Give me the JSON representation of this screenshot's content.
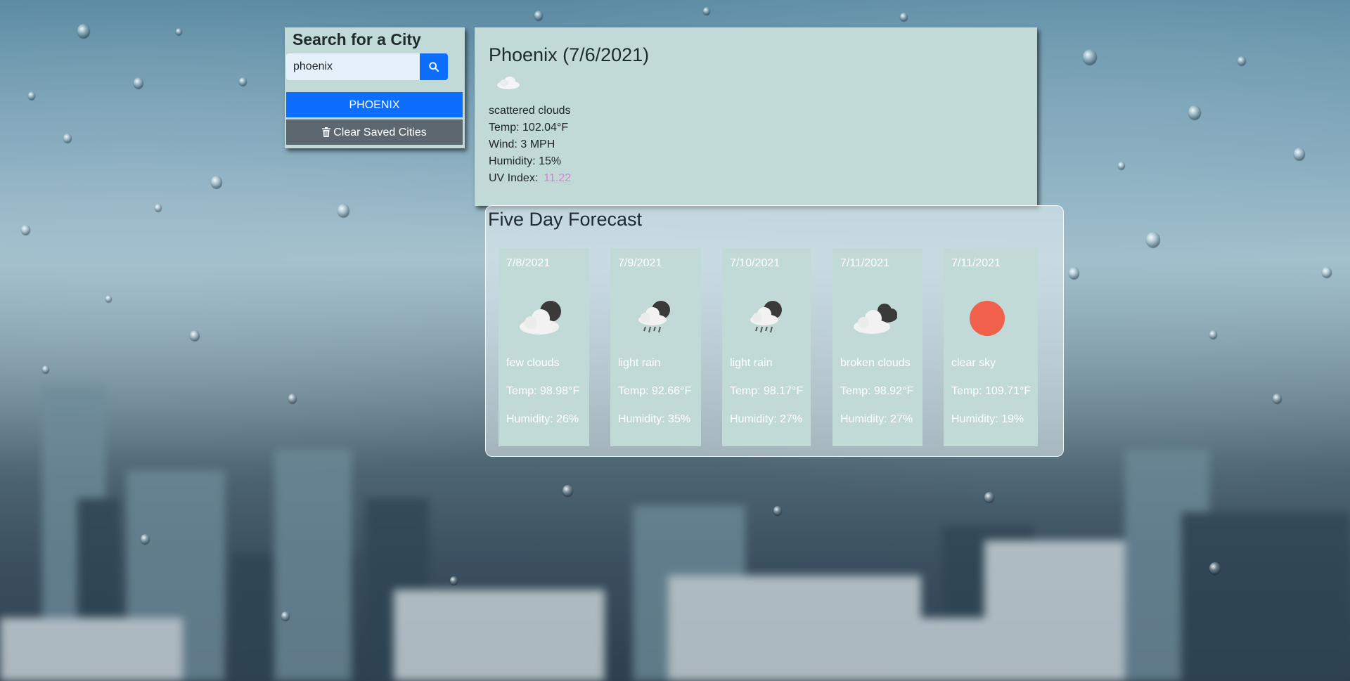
{
  "search": {
    "title": "Search for a City",
    "query": "phoenix",
    "saved_city": "PHOENIX",
    "clear_label": "Clear Saved Cities"
  },
  "current": {
    "title": "Phoenix (7/6/2021)",
    "icon": "scattered-clouds-icon",
    "description": "scattered clouds",
    "temp": "Temp: 102.04°F",
    "wind": "Wind: 3 MPH",
    "humidity": "Humidity: 15%",
    "uv_label": "UV Index:",
    "uv_value": "11.22",
    "uv_color": "#e27ad6"
  },
  "forecast": {
    "title": "Five Day Forecast",
    "days": [
      {
        "date": "7/8/2021",
        "icon": "few-clouds-night-icon",
        "desc": "few clouds",
        "temp": "Temp: 98.98°F",
        "humidity": "Humidity: 26%"
      },
      {
        "date": "7/9/2021",
        "icon": "light-rain-night-icon",
        "desc": "light rain",
        "temp": "Temp: 92.66°F",
        "humidity": "Humidity: 35%"
      },
      {
        "date": "7/10/2021",
        "icon": "light-rain-night-icon",
        "desc": "light rain",
        "temp": "Temp: 98.17°F",
        "humidity": "Humidity: 27%"
      },
      {
        "date": "7/11/2021",
        "icon": "broken-clouds-icon",
        "desc": "broken clouds",
        "temp": "Temp: 98.92°F",
        "humidity": "Humidity: 27%"
      },
      {
        "date": "7/11/2021",
        "icon": "clear-sky-icon",
        "desc": "clear sky",
        "temp": "Temp: 109.71°F",
        "humidity": "Humidity: 19%"
      }
    ]
  },
  "colors": {
    "panel": "#c1dad8",
    "primary": "#0d6efd",
    "secondary": "#5c6770",
    "sun": "#f0604b"
  }
}
